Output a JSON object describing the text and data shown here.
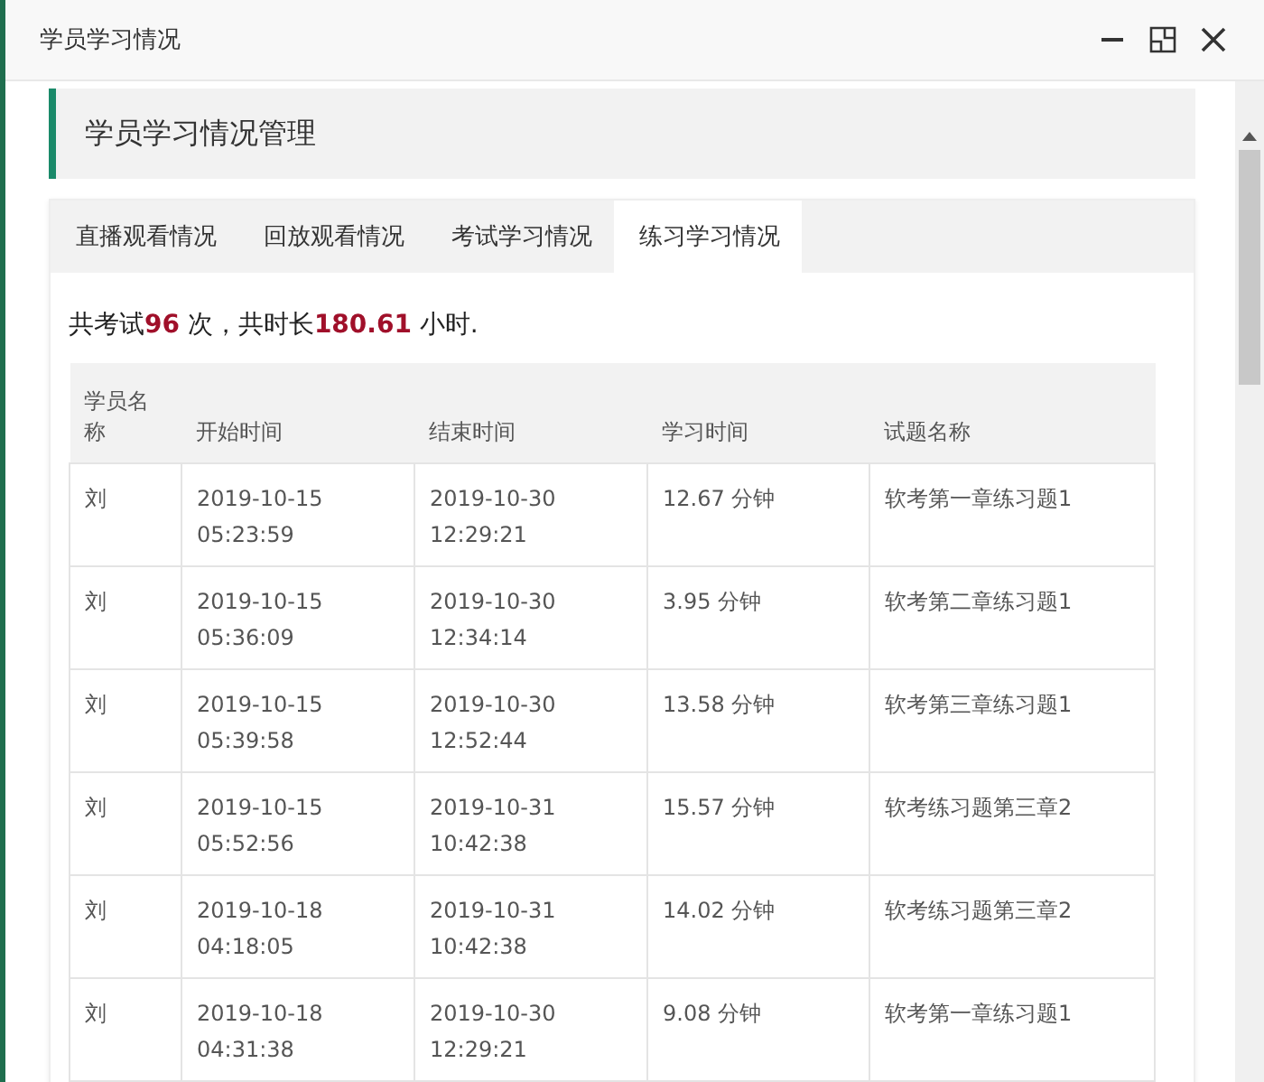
{
  "window": {
    "title": "学员学习情况"
  },
  "header": {
    "title": "学员学习情况管理"
  },
  "tabs": [
    {
      "label": "直播观看情况",
      "selected": false
    },
    {
      "label": "回放观看情况",
      "selected": false
    },
    {
      "label": "考试学习情况",
      "selected": false
    },
    {
      "label": "练习学习情况",
      "selected": true
    }
  ],
  "summary": "共考试**96** 次，共时长**180.61** 小时.",
  "table": {
    "columns": [
      "学员名称",
      "开始时间",
      "结束时间",
      "学习时间",
      "试题名称"
    ],
    "rows": [
      [
        "刘",
        "2019-10-15 05:23:59",
        "2019-10-30 12:29:21",
        "12.67  分钟",
        "软考第一章练习题1"
      ],
      [
        "刘",
        "2019-10-15 05:36:09",
        "2019-10-30 12:34:14",
        "3.95  分钟",
        "软考第二章练习题1"
      ],
      [
        "刘",
        "2019-10-15 05:39:58",
        "2019-10-30 12:52:44",
        "13.58  分钟",
        "软考第三章练习题1"
      ],
      [
        "刘",
        "2019-10-15 05:52:56",
        "2019-10-31 10:42:38",
        "15.57  分钟",
        "软考练习题第三章2"
      ],
      [
        "刘",
        "2019-10-18 04:18:05",
        "2019-10-31 10:42:38",
        "14.02  分钟",
        "软考练习题第三章2"
      ],
      [
        "刘",
        "2019-10-18 04:31:38",
        "2019-10-30 12:29:21",
        "9.08  分钟",
        "软考第一章练习题1"
      ]
    ]
  }
}
